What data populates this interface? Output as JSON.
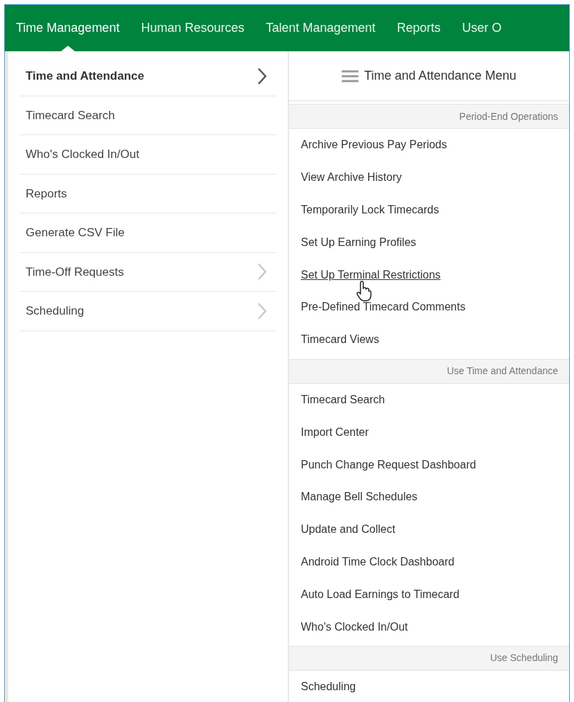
{
  "nav": [
    {
      "label": "Time Management",
      "selected": true
    },
    {
      "label": "Human Resources",
      "selected": false
    },
    {
      "label": "Talent Management",
      "selected": false
    },
    {
      "label": "Reports",
      "selected": false
    },
    {
      "label": "User O",
      "selected": false
    }
  ],
  "left_menu": [
    {
      "label": "Time and Attendance",
      "selected": true,
      "submenu": true
    },
    {
      "label": "Timecard Search",
      "selected": false,
      "submenu": false
    },
    {
      "label": "Who's Clocked In/Out",
      "selected": false,
      "submenu": false
    },
    {
      "label": "Reports",
      "selected": false,
      "submenu": false
    },
    {
      "label": "Generate CSV File",
      "selected": false,
      "submenu": false
    },
    {
      "label": "Time-Off Requests",
      "selected": false,
      "submenu": true
    },
    {
      "label": "Scheduling",
      "selected": false,
      "submenu": true
    }
  ],
  "right_menu": {
    "title": "Time and Attendance Menu",
    "sections": [
      {
        "heading": "Period-End Operations",
        "items": [
          {
            "label": "Archive Previous Pay Periods",
            "hovered": false
          },
          {
            "label": "View Archive History",
            "hovered": false
          },
          {
            "label": "Temporarily Lock Timecards",
            "hovered": false
          },
          {
            "label": "Set Up Earning Profiles",
            "hovered": false
          },
          {
            "label": "Set Up Terminal Restrictions",
            "hovered": true
          },
          {
            "label": "Pre-Defined Timecard Comments",
            "hovered": false
          },
          {
            "label": "Timecard Views",
            "hovered": false
          }
        ]
      },
      {
        "heading": "Use Time and Attendance",
        "items": [
          {
            "label": "Timecard Search",
            "hovered": false
          },
          {
            "label": "Import Center",
            "hovered": false
          },
          {
            "label": "Punch Change Request Dashboard",
            "hovered": false
          },
          {
            "label": "Manage Bell Schedules",
            "hovered": false
          },
          {
            "label": "Update and Collect",
            "hovered": false
          },
          {
            "label": "Android Time Clock Dashboard",
            "hovered": false
          },
          {
            "label": "Auto Load Earnings to Timecard",
            "hovered": false
          },
          {
            "label": "Who's Clocked In/Out",
            "hovered": false
          }
        ]
      },
      {
        "heading": "Use Scheduling",
        "items": [
          {
            "label": "Scheduling",
            "hovered": false
          }
        ]
      }
    ]
  }
}
